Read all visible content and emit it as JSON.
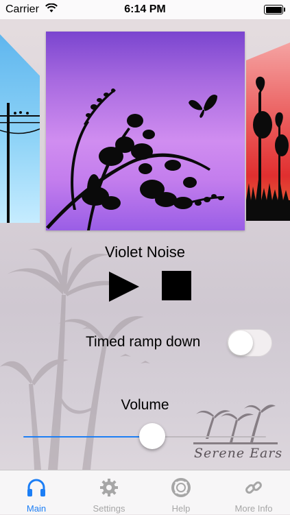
{
  "status_bar": {
    "carrier": "Carrier",
    "time": "6:14 PM",
    "wifi_icon": "wifi-icon",
    "battery_icon": "battery-icon"
  },
  "player": {
    "track_title": "Violet Noise",
    "play_icon": "play-icon",
    "stop_icon": "stop-icon"
  },
  "timed_ramp": {
    "label": "Timed ramp down",
    "enabled": false
  },
  "volume": {
    "label": "Volume",
    "level": 0.53
  },
  "brand": {
    "name": "Serene Ears"
  },
  "tabs": [
    {
      "label": "Main",
      "icon": "headphones-icon",
      "active": true
    },
    {
      "label": "Settings",
      "icon": "gear-icon",
      "active": false
    },
    {
      "label": "Help",
      "icon": "lifebuoy-icon",
      "active": false
    },
    {
      "label": "More Info",
      "icon": "link-icon",
      "active": false
    }
  ],
  "colors": {
    "accent": "#1c7ef5",
    "inactive_tab": "#a6a6a6"
  }
}
